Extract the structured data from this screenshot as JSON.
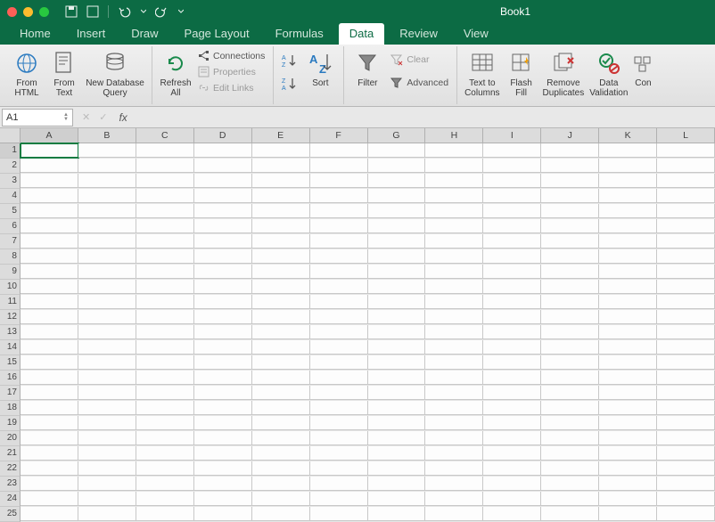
{
  "window": {
    "title": "Book1"
  },
  "tabs": {
    "items": [
      {
        "label": "Home"
      },
      {
        "label": "Insert"
      },
      {
        "label": "Draw"
      },
      {
        "label": "Page Layout"
      },
      {
        "label": "Formulas"
      },
      {
        "label": "Data",
        "active": true
      },
      {
        "label": "Review"
      },
      {
        "label": "View"
      }
    ]
  },
  "ribbon": {
    "fromHtml": "From\nHTML",
    "fromText": "From\nText",
    "newDbQuery": "New Database\nQuery",
    "refreshAll": "Refresh\nAll",
    "connections": "Connections",
    "properties": "Properties",
    "editLinks": "Edit Links",
    "sort": "Sort",
    "filter": "Filter",
    "clear": "Clear",
    "advanced": "Advanced",
    "textToColumns": "Text to\nColumns",
    "flashFill": "Flash\nFill",
    "removeDuplicates": "Remove\nDuplicates",
    "dataValidation": "Data\nValidation",
    "consolidate": "Con"
  },
  "formulaBar": {
    "cellRef": "A1",
    "formula": "",
    "fx": "fx"
  },
  "grid": {
    "columns": [
      "A",
      "B",
      "C",
      "D",
      "E",
      "F",
      "G",
      "H",
      "I",
      "J",
      "K",
      "L"
    ],
    "rows": 25,
    "selected": {
      "col": 0,
      "row": 0
    }
  }
}
